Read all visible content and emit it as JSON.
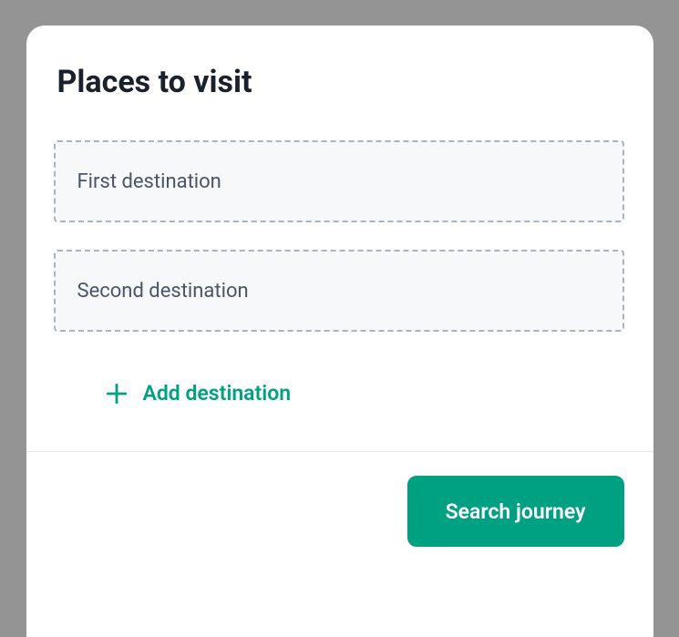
{
  "title": "Places to visit",
  "destinations": [
    {
      "placeholder": "First destination",
      "value": ""
    },
    {
      "placeholder": "Second destination",
      "value": ""
    }
  ],
  "add_destination_label": "Add destination",
  "search_button_label": "Search journey",
  "colors": {
    "accent": "#00a082",
    "background": "#949494",
    "card": "#ffffff",
    "input_bg": "#f6f8fa",
    "input_border": "#a9b4c0"
  }
}
